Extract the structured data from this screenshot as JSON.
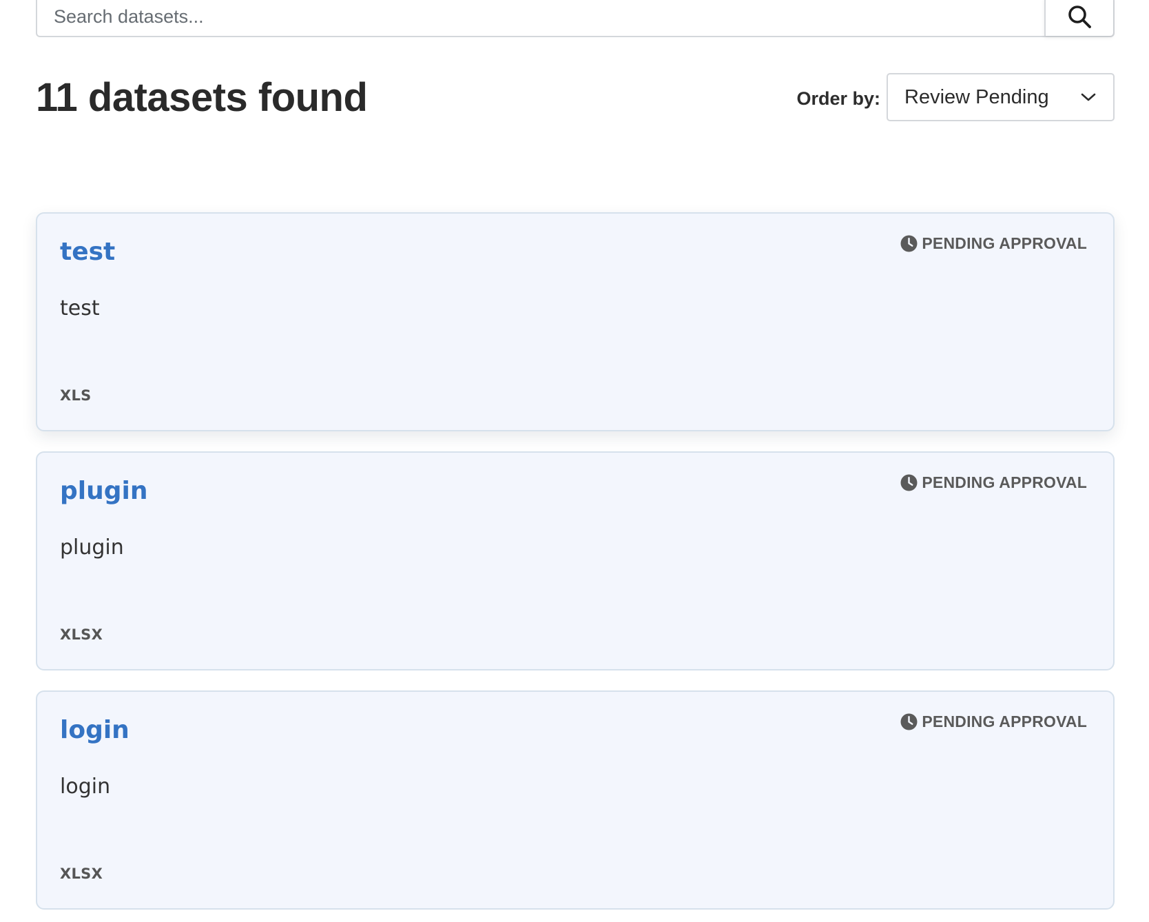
{
  "search": {
    "placeholder": "Search datasets...",
    "value": ""
  },
  "results": {
    "count_title": "11 datasets found"
  },
  "order": {
    "label": "Order by:",
    "selected": "Review Pending"
  },
  "datasets": [
    {
      "title": "test",
      "description": "test",
      "format": "XLS",
      "status": "PENDING APPROVAL"
    },
    {
      "title": "plugin",
      "description": "plugin",
      "format": "XLSX",
      "status": "PENDING APPROVAL"
    },
    {
      "title": "login",
      "description": "login",
      "format": "XLSX",
      "status": "PENDING APPROVAL"
    }
  ],
  "colors": {
    "link": "#3473c3",
    "card_bg": "#f3f6fd",
    "card_border": "#d6e1ec",
    "status_icon": "#5a5a5a"
  },
  "icons": {
    "search_button": "search-icon",
    "order_dropdown": "chevron-down-icon",
    "status": "clock-icon"
  }
}
